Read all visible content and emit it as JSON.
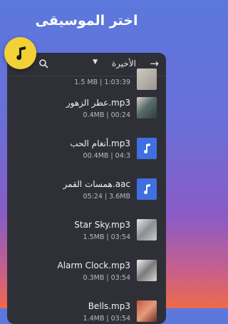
{
  "header": {
    "title": "اختر الموسيقى"
  },
  "toolbar": {
    "back_icon": "arrow-right-icon",
    "sort_label": "الأخيرة",
    "caret": "▼",
    "search_icon": "search-icon"
  },
  "fab": {
    "icon": "music-note-icon",
    "color": "#f3d035"
  },
  "tracks": [
    {
      "name": "",
      "meta": "1.5 MB | 1:03:39",
      "thumb": "photo"
    },
    {
      "name": "عطر الزهور.mp3",
      "meta": "0.4MB | 00:24",
      "thumb": "photo"
    },
    {
      "name": "أنغام الحب.mp3",
      "meta": "00.4MB | 04:3",
      "thumb": "music-note"
    },
    {
      "name": "همسات القمر.aac",
      "meta": "05:24 | 3.6MB",
      "thumb": "music-note"
    },
    {
      "name": "Star Sky.mp3",
      "meta": "1.5MB | 03:54",
      "thumb": "photo"
    },
    {
      "name": "Alarm Clock.mp3",
      "meta": "0.3MB | 03:54",
      "thumb": "photo"
    },
    {
      "name": "Bells.mp3",
      "meta": "1.4MB | 03:54",
      "thumb": "photo"
    }
  ],
  "colors": {
    "panel": "#2f3037",
    "accent": "#3f6fe0",
    "fab": "#f3d035"
  }
}
